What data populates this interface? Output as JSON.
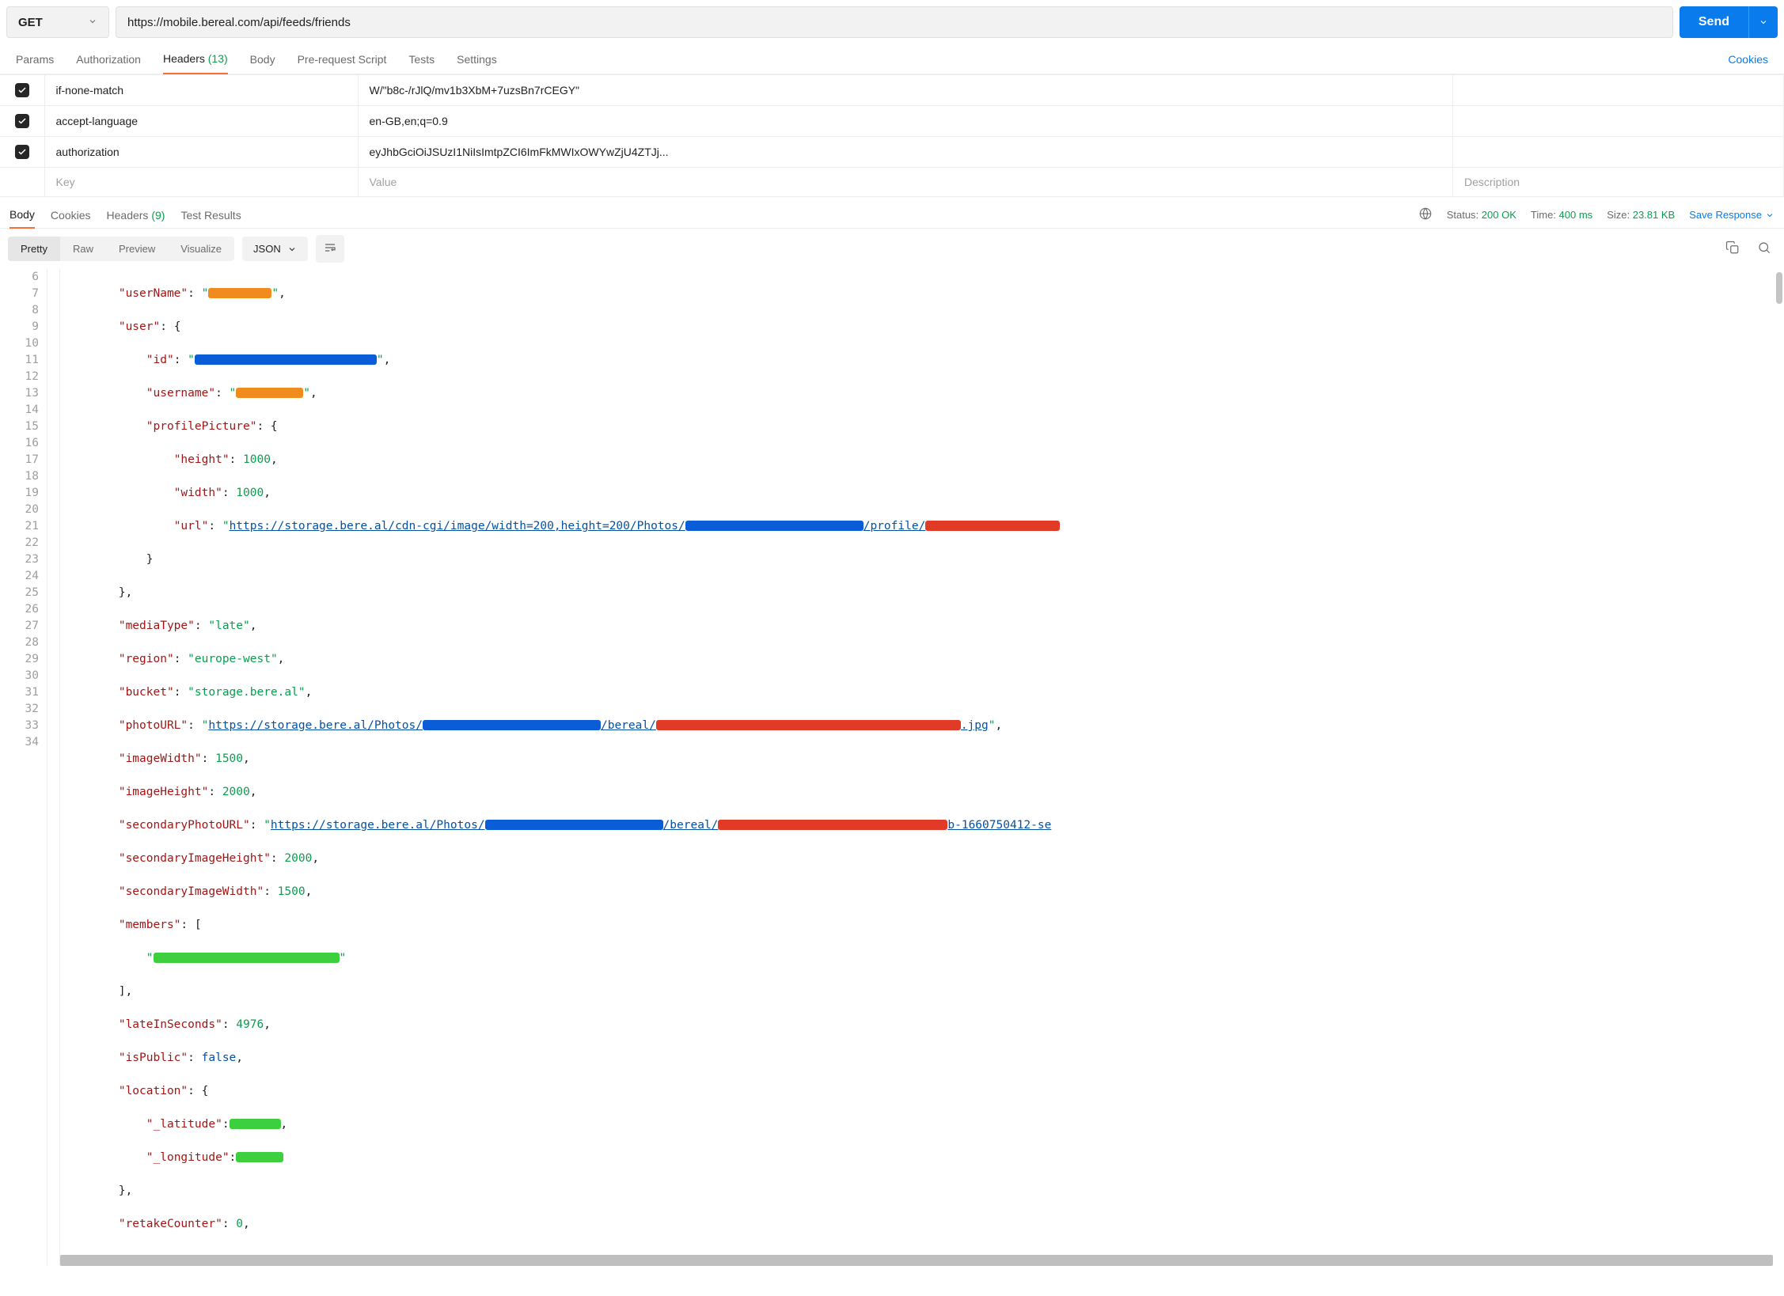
{
  "request": {
    "method": "GET",
    "url": "https://mobile.bereal.com/api/feeds/friends",
    "send_label": "Send"
  },
  "req_tabs": {
    "params": "Params",
    "authorization": "Authorization",
    "headers": "Headers",
    "headers_count": "(13)",
    "body": "Body",
    "prerequest": "Pre-request Script",
    "tests": "Tests",
    "settings": "Settings",
    "cookies": "Cookies"
  },
  "headers_rows": [
    {
      "key": "if-none-match",
      "value": "W/\"b8c-/rJlQ/mv1b3XbM+7uzsBn7rCEGY\""
    },
    {
      "key": "accept-language",
      "value": "en-GB,en;q=0.9"
    },
    {
      "key": "authorization",
      "value": "eyJhbGciOiJSUzI1NiIsImtpZCI6ImFkMWIxOWYwZjU4ZTJj..."
    }
  ],
  "headers_placeholder": {
    "key": "Key",
    "value": "Value",
    "desc": "Description"
  },
  "resp_tabs": {
    "body": "Body",
    "cookies": "Cookies",
    "headers": "Headers",
    "headers_count": "(9)",
    "test_results": "Test Results"
  },
  "resp_meta": {
    "status_label": "Status:",
    "status_value": "200 OK",
    "time_label": "Time:",
    "time_value": "400 ms",
    "size_label": "Size:",
    "size_value": "23.81 KB",
    "save_response": "Save Response"
  },
  "view_bar": {
    "pretty": "Pretty",
    "raw": "Raw",
    "preview": "Preview",
    "visualize": "Visualize",
    "format": "JSON"
  },
  "code": {
    "line_start": 6,
    "lines": {
      "l6_key": "userName",
      "l7_key": "user",
      "l8_key": "id",
      "l9_key": "username",
      "l10_key": "profilePicture",
      "l11_key": "height",
      "l11_val": "1000",
      "l12_key": "width",
      "l12_val": "1000",
      "l13_key": "url",
      "l13_url_a": "https://storage.bere.al/cdn-cgi/image/width=200,height=200/Photos/",
      "l13_url_b": "/profile/",
      "l16_key": "mediaType",
      "l16_val": "late",
      "l17_key": "region",
      "l17_val": "europe-west",
      "l18_key": "bucket",
      "l18_val": "storage.bere.al",
      "l19_key": "photoURL",
      "l19_url_a": "https://storage.bere.al/Photos/",
      "l19_url_b": "/bereal/",
      "l19_url_c": ".jpg",
      "l20_key": "imageWidth",
      "l20_val": "1500",
      "l21_key": "imageHeight",
      "l21_val": "2000",
      "l22_key": "secondaryPhotoURL",
      "l22_url_a": "https://storage.bere.al/Photos/",
      "l22_url_b": "/bereal/",
      "l22_url_c": "b-1660750412-se",
      "l23_key": "secondaryImageHeight",
      "l23_val": "2000",
      "l24_key": "secondaryImageWidth",
      "l24_val": "1500",
      "l25_key": "members",
      "l28_key": "lateInSeconds",
      "l28_val": "4976",
      "l29_key": "isPublic",
      "l29_val": "false",
      "l30_key": "location",
      "l31_key": "_latitude",
      "l32_key": "_longitude",
      "l34_key": "retakeCounter",
      "l34_val": "0"
    }
  }
}
